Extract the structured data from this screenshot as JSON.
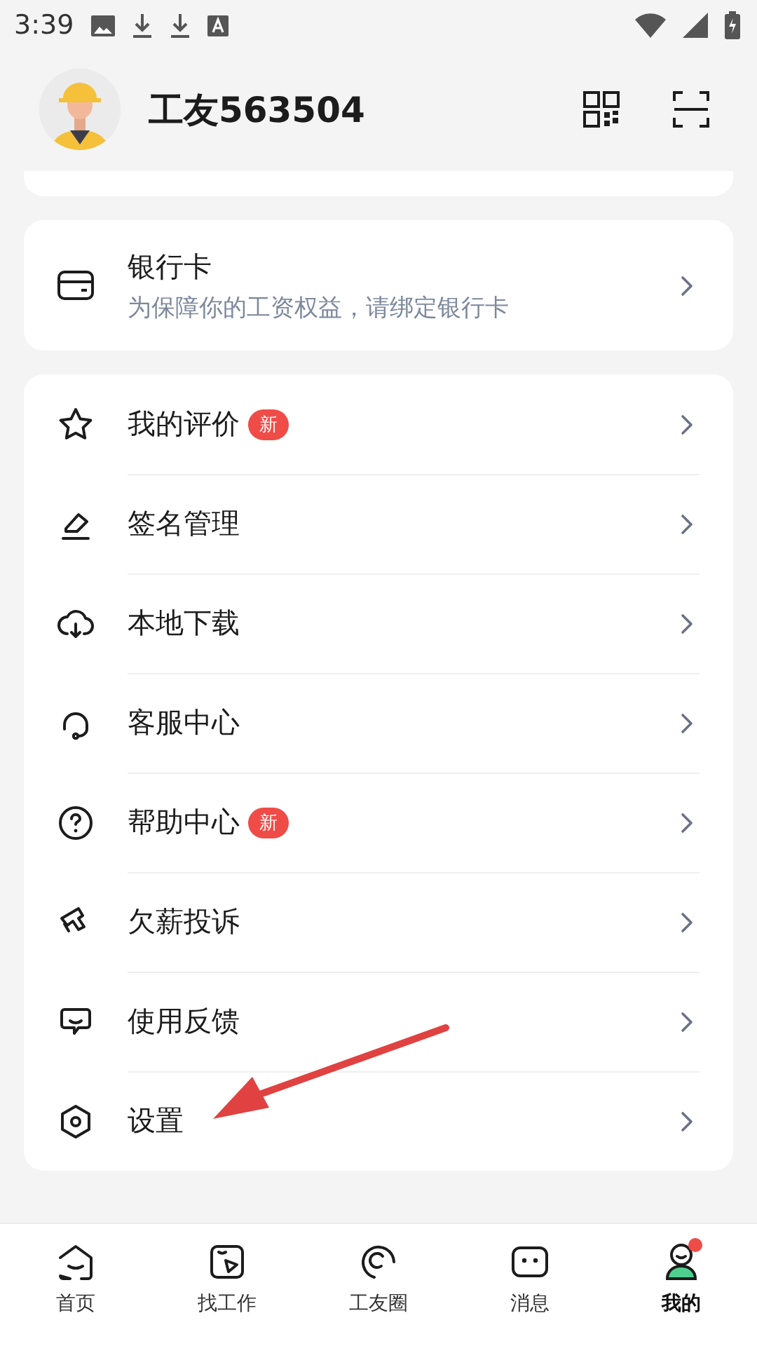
{
  "status_bar": {
    "time": "3:39"
  },
  "profile": {
    "name": "工友563504"
  },
  "bank_card": {
    "title": "银行卡",
    "subtitle": "为保障你的工资权益，请绑定银行卡"
  },
  "menu": [
    {
      "label": "我的评价",
      "badge": "新"
    },
    {
      "label": "签名管理"
    },
    {
      "label": "本地下载"
    },
    {
      "label": "客服中心"
    },
    {
      "label": "帮助中心",
      "badge": "新"
    },
    {
      "label": "欠薪投诉"
    },
    {
      "label": "使用反馈"
    },
    {
      "label": "设置"
    }
  ],
  "bottom_nav": [
    {
      "label": "首页",
      "selected": false,
      "dot": false
    },
    {
      "label": "找工作",
      "selected": false,
      "dot": false
    },
    {
      "label": "工友圈",
      "selected": false,
      "dot": false
    },
    {
      "label": "消息",
      "selected": false,
      "dot": false
    },
    {
      "label": "我的",
      "selected": true,
      "dot": true
    }
  ]
}
